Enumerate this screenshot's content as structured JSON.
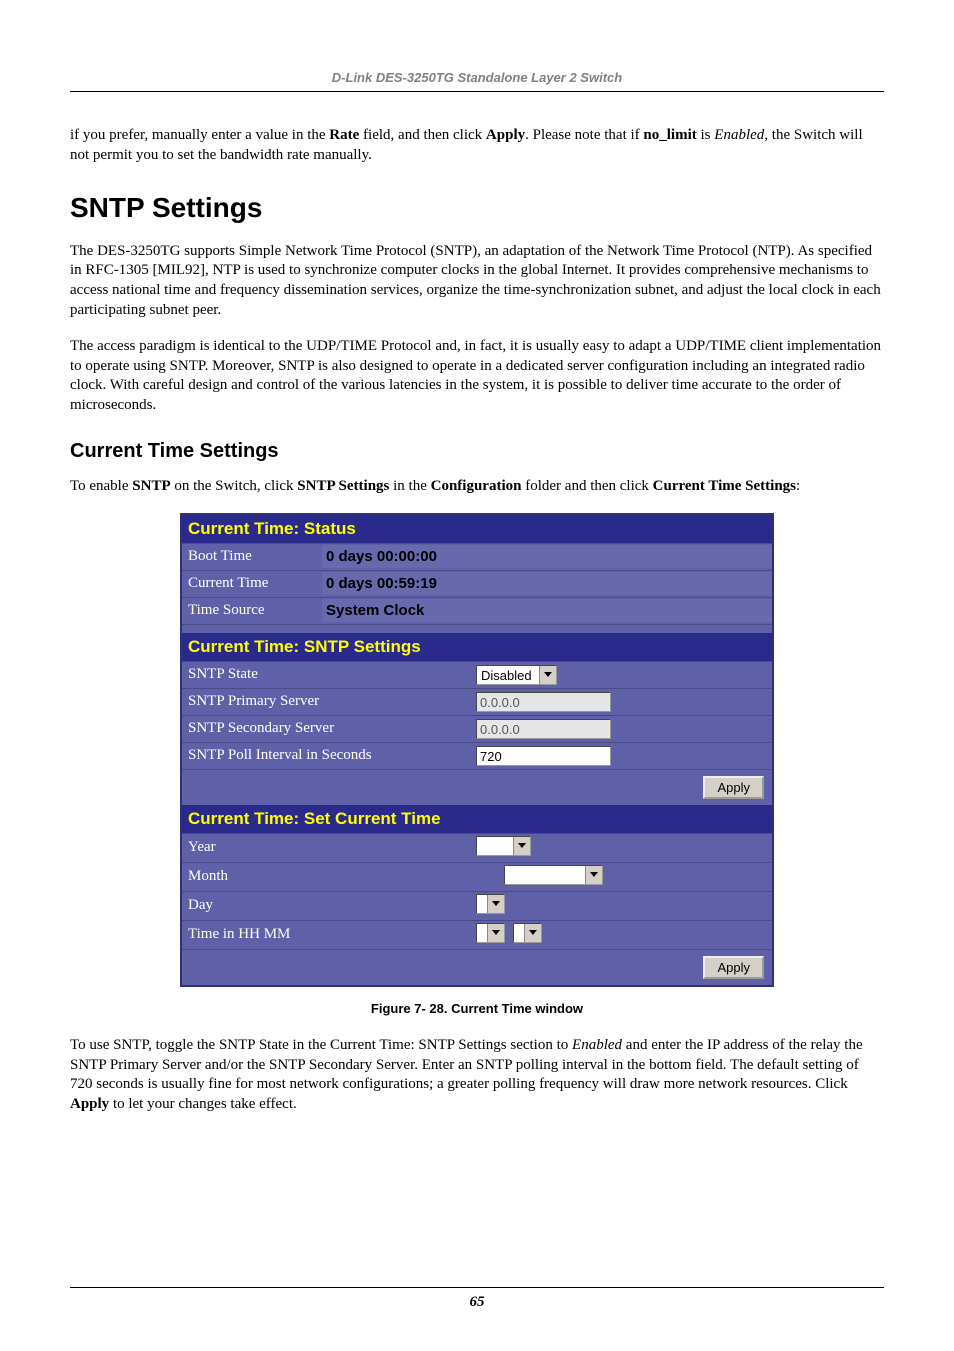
{
  "header": {
    "running": "D-Link DES-3250TG Standalone Layer 2 Switch"
  },
  "intro": {
    "pre": "if you prefer, manually enter a value in the ",
    "rate": "Rate",
    "mid1": " field, and then click ",
    "apply": "Apply",
    "mid2": ". Please note that if ",
    "nolimit": "no_limit",
    "mid3": " is ",
    "enabled": "Enabled",
    "tail": ", the Switch will not permit you to set the bandwidth rate manually."
  },
  "h1": "SNTP Settings",
  "p1": "The DES-3250TG supports Simple Network Time Protocol (SNTP), an adaptation of the Network Time Protocol (NTP). As specified in RFC-1305 [MIL92], NTP is used to synchronize computer clocks in the global Internet. It provides comprehensive mechanisms to access national time and frequency dissemination services, organize the time-synchronization subnet, and adjust the local clock in each participating subnet peer.",
  "p2": "The access paradigm is identical to the UDP/TIME Protocol and, in fact, it is usually easy to adapt a UDP/TIME client implementation to operate using SNTP. Moreover, SNTP is also designed to operate in a dedicated server configuration including an integrated radio clock. With careful design and control of the various latencies in the system, it is possible to deliver time accurate to the order of microseconds.",
  "h2": "Current Time Settings",
  "enable": {
    "pre": "To enable ",
    "sntp": "SNTP",
    "mid1": " on the Switch, click ",
    "sntpset": "SNTP Settings",
    "mid2": " in the ",
    "config": "Configuration",
    "mid3": " folder and then click ",
    "cts": "Current Time Settings",
    "tail": ":"
  },
  "panel": {
    "status_title": "Current Time: Status",
    "boot_label": "Boot Time",
    "boot_val": "0 days 00:00:00",
    "current_label": "Current Time",
    "current_val": "0 days 00:59:19",
    "source_label": "Time Source",
    "source_val": "System Clock",
    "sntp_title": "Current Time: SNTP Settings",
    "state_label": "SNTP State",
    "state_val": "Disabled",
    "prim_label": "SNTP Primary Server",
    "prim_val": "0.0.0.0",
    "sec_label": "SNTP Secondary Server",
    "sec_val": "0.0.0.0",
    "poll_label": "SNTP Poll Interval in Seconds",
    "poll_val": "720",
    "apply": "Apply",
    "set_title": "Current Time: Set Current Time",
    "year_label": "Year",
    "month_label": "Month",
    "day_label": "Day",
    "hhmm_label": "Time in HH MM"
  },
  "figure_caption": "Figure 7- 28.  Current Time window",
  "usage": {
    "pre": "To use SNTP, toggle the SNTP State in the Current Time: SNTP Settings section to ",
    "enabled": "Enabled",
    "mid": " and enter the IP address of the relay the SNTP Primary Server and/or the SNTP Secondary Server. Enter an SNTP polling interval in the bottom field. The default setting of 720 seconds is usually fine for most network configurations; a greater polling frequency will draw more network resources. Click ",
    "apply": "Apply",
    "tail": " to let your changes take effect."
  },
  "page_number": "65"
}
